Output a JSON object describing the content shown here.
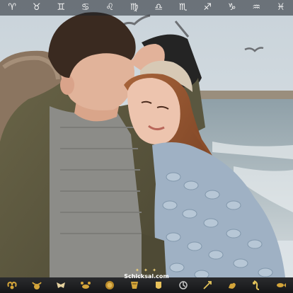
{
  "top_bar": {
    "symbols": [
      {
        "name": "aries",
        "glyph": "♈"
      },
      {
        "name": "taurus",
        "glyph": "♉"
      },
      {
        "name": "gemini",
        "glyph": "♊"
      },
      {
        "name": "cancer",
        "glyph": "♋"
      },
      {
        "name": "leo",
        "glyph": "♌"
      },
      {
        "name": "virgo",
        "glyph": "♍"
      },
      {
        "name": "libra",
        "glyph": "♎"
      },
      {
        "name": "scorpio",
        "glyph": "♏"
      },
      {
        "name": "sagittarius",
        "glyph": "♐"
      },
      {
        "name": "capricorn",
        "glyph": "♑"
      },
      {
        "name": "aquarius",
        "glyph": "♒"
      },
      {
        "name": "pisces",
        "glyph": "♓"
      }
    ]
  },
  "brand": {
    "name": "Schicksal.com",
    "stars": "✦ ✦ ✦"
  },
  "bottom_bar": {
    "icons": [
      "ram-icon",
      "bull-icon",
      "twins-icon",
      "crab-icon",
      "lion-icon",
      "maiden-icon",
      "scales-icon",
      "scorpion-icon",
      "archer-icon",
      "goat-icon",
      "water-bearer-icon",
      "fish-icon"
    ]
  },
  "colors": {
    "gold": "#d4a53a",
    "bar_dark": "#1b1c1e",
    "sky": "#d3dbe0",
    "sea": "#8d9ea6"
  }
}
